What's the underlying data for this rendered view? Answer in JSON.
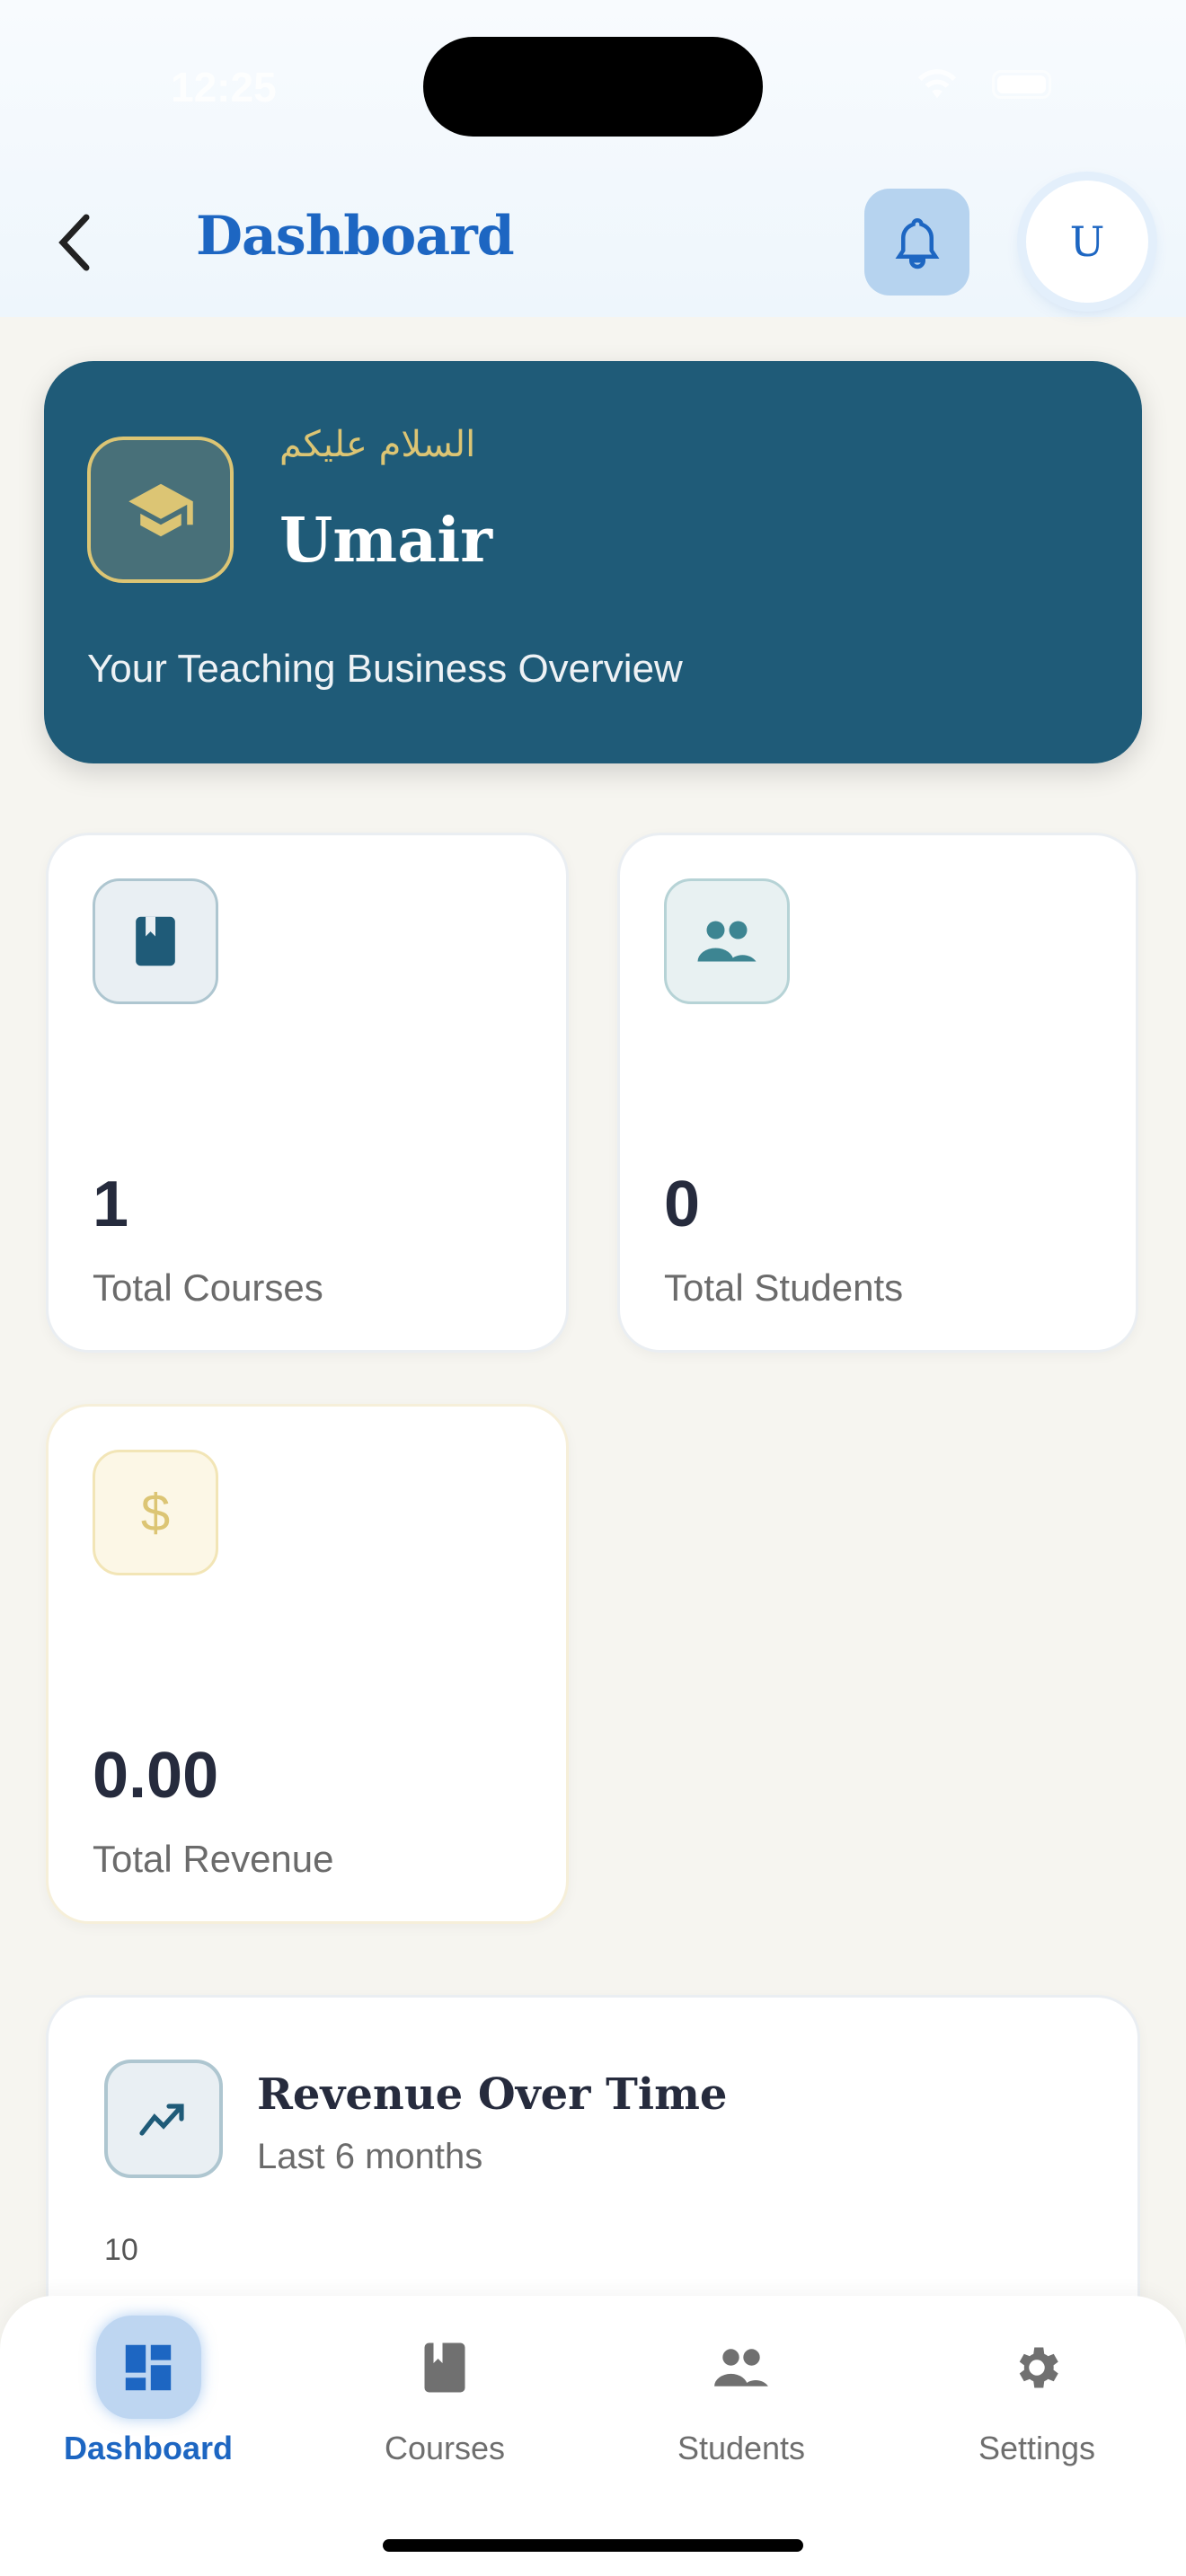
{
  "status_bar": {
    "time": "12:25"
  },
  "header": {
    "title": "Dashboard",
    "avatar_initial": "U"
  },
  "hero": {
    "greeting": "السلام عليكم",
    "name": "Umair",
    "subtitle": "Your Teaching Business Overview"
  },
  "stats": [
    {
      "value": "1",
      "label": "Total Courses",
      "icon": "book-icon"
    },
    {
      "value": "0",
      "label": "Total Students",
      "icon": "people-icon"
    },
    {
      "value": "0.00",
      "label": "Total Revenue",
      "icon": "dollar-icon"
    }
  ],
  "revenue_chart": {
    "title": "Revenue Over Time",
    "subtitle": "Last 6 months",
    "y_tick_top": "10"
  },
  "nav": [
    {
      "label": "Dashboard",
      "active": true
    },
    {
      "label": "Courses"
    },
    {
      "label": "Students"
    },
    {
      "label": "Settings"
    }
  ],
  "colors": {
    "primary": "#1d66c2",
    "hero": "#1f5b78",
    "gold": "#dcc574"
  }
}
